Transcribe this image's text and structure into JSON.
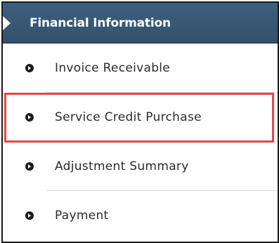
{
  "panel": {
    "title": "Financial Information",
    "items": [
      {
        "label": "Invoice Receivable",
        "icon": "bullet-arrow-icon"
      },
      {
        "label": "Service Credit Purchase",
        "icon": "bullet-arrow-icon",
        "highlighted": true
      },
      {
        "label": "Adjustment Summary",
        "icon": "bullet-arrow-icon"
      },
      {
        "label": "Payment",
        "icon": "bullet-arrow-icon"
      }
    ],
    "colors": {
      "header_bg": "#34546f",
      "highlight_border": "#e04848",
      "text": "#2b2b2b"
    }
  }
}
